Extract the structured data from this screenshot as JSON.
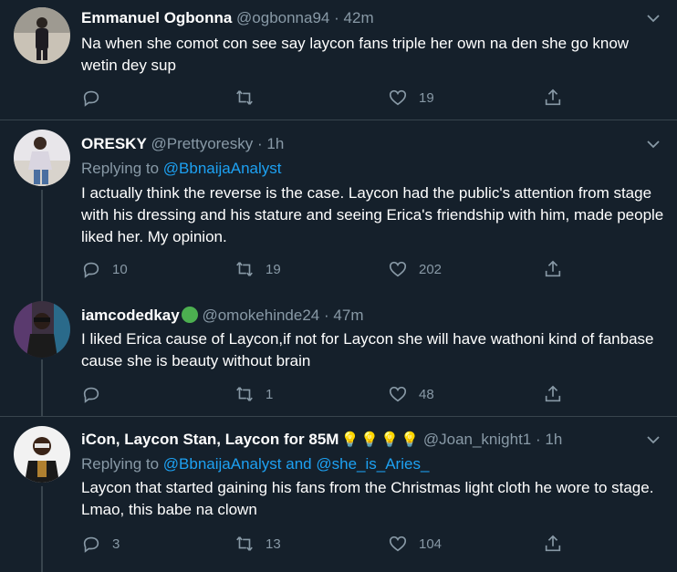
{
  "tweets": [
    {
      "name": "Emmanuel Ogbonna",
      "handle": "@ogbonna94",
      "time": "42m",
      "reply_prefix": "",
      "reply_to": "",
      "body": "Na when she comot con see say laycon fans triple her own na den she go know wetin dey sup",
      "replies": "",
      "retweets": "",
      "likes": "19"
    },
    {
      "name": "ORESKY",
      "handle": "@Prettyoresky",
      "time": "1h",
      "reply_prefix": "Replying to",
      "reply_to": "@BbnaijaAnalyst",
      "body": "I actually think the reverse is the case. Laycon had the public's attention from stage with his dressing and his stature and seeing Erica's friendship with him, made people liked her. My opinion.",
      "replies": "10",
      "retweets": "19",
      "likes": "202"
    },
    {
      "name": "iamcodedkay",
      "handle": "@omokehinde24",
      "time": "47m",
      "reply_prefix": "",
      "reply_to": "",
      "body": "I liked Erica cause of Laycon,if not for Laycon she will have wathoni kind of fanbase cause she is beauty without brain",
      "replies": "",
      "retweets": "1",
      "likes": "48"
    },
    {
      "name": "iCon, Laycon Stan, Laycon for 85M",
      "handle": "@Joan_knight1",
      "time": "1h",
      "reply_prefix": "Replying to",
      "reply_to": "@BbnaijaAnalyst",
      "reply_and": "and",
      "reply_to_2": "@she_is_Aries_",
      "body": "Laycon that started gaining his fans from the Christmas light cloth he wore to stage. Lmao, this babe na clown",
      "replies": "3",
      "retweets": "13",
      "likes": "104"
    }
  ],
  "separator": "·",
  "icons": {
    "reply": "reply-icon",
    "retweet": "retweet-icon",
    "like": "heart-icon",
    "share": "share-icon",
    "more": "chevron-down-icon",
    "emoji": "light-bulb-emoji"
  },
  "colors": {
    "background": "#15202b",
    "link": "#1da1f2",
    "muted": "#8899a6",
    "divider": "#38444d"
  }
}
